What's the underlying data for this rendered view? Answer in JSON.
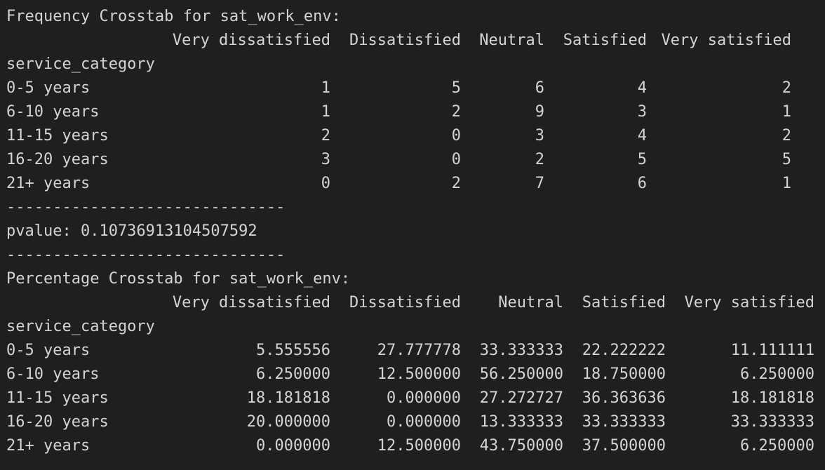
{
  "freq": {
    "title": "Frequency Crosstab for sat_work_env:",
    "columns": [
      "Very dissatisfied",
      "Dissatisfied",
      "Neutral",
      "Satisfied",
      "Very satisfied"
    ],
    "index_name": "service_category",
    "rows": [
      {
        "label": "0-5 years",
        "values": [
          "1",
          "5",
          "6",
          "4",
          "2"
        ]
      },
      {
        "label": "6-10 years",
        "values": [
          "1",
          "2",
          "9",
          "3",
          "1"
        ]
      },
      {
        "label": "11-15 years",
        "values": [
          "2",
          "0",
          "3",
          "4",
          "2"
        ]
      },
      {
        "label": "16-20 years",
        "values": [
          "3",
          "0",
          "2",
          "5",
          "5"
        ]
      },
      {
        "label": "21+ years",
        "values": [
          "0",
          "2",
          "7",
          "6",
          "1"
        ]
      }
    ]
  },
  "separator_top": "------------------------------",
  "pvalue": "pvalue: 0.10736913104507592",
  "separator_bottom": "------------------------------",
  "pct": {
    "title": "Percentage Crosstab for sat_work_env:",
    "columns": [
      "Very dissatisfied",
      "Dissatisfied",
      "Neutral",
      "Satisfied",
      "Very satisfied"
    ],
    "index_name": "service_category",
    "rows": [
      {
        "label": "0-5 years",
        "values": [
          "5.555556",
          "27.777778",
          "33.333333",
          "22.222222",
          "11.111111"
        ]
      },
      {
        "label": "6-10 years",
        "values": [
          "6.250000",
          "12.500000",
          "56.250000",
          "18.750000",
          "6.250000"
        ]
      },
      {
        "label": "11-15 years",
        "values": [
          "18.181818",
          "0.000000",
          "27.272727",
          "36.363636",
          "18.181818"
        ]
      },
      {
        "label": "16-20 years",
        "values": [
          "20.000000",
          "0.000000",
          "13.333333",
          "33.333333",
          "33.333333"
        ]
      },
      {
        "label": "21+ years",
        "values": [
          "0.000000",
          "12.500000",
          "43.750000",
          "37.500000",
          "6.250000"
        ]
      }
    ]
  }
}
